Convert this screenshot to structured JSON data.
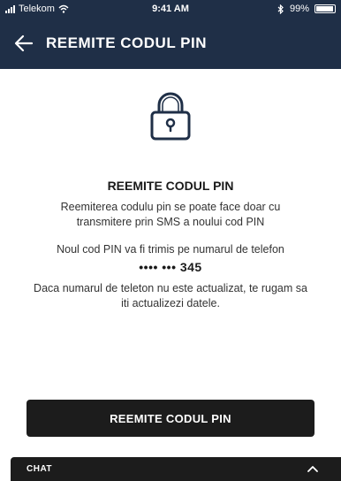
{
  "status_bar": {
    "carrier": "Telekom",
    "time": "9:41 AM",
    "battery": "99%"
  },
  "nav": {
    "title": "REEMITE CODUL PIN"
  },
  "main": {
    "title": "REEMITE CODUL PIN",
    "description": "Reemiterea codulu pin se poate face doar cu transmitere prin SMS a noului cod PIN",
    "phone_label": "Noul cod PIN va fi trimis pe numarul de telefon",
    "phone_number": "•••• ••• 345",
    "update_note": "Daca numarul de teleton nu este actualizat, te rugam sa iti actualizezi datele."
  },
  "actions": {
    "reset_button_label": "REEMITE CODUL PIN"
  },
  "chat": {
    "label": "CHAT"
  },
  "colors": {
    "header_bg": "#1f2f47",
    "button_bg": "#1c1c1c",
    "icon": "#1f2f47"
  },
  "icons": [
    "signal-icon",
    "wifi-icon",
    "bluetooth-icon",
    "battery-icon",
    "back-arrow-icon",
    "lock-icon",
    "chevron-up-icon"
  ]
}
